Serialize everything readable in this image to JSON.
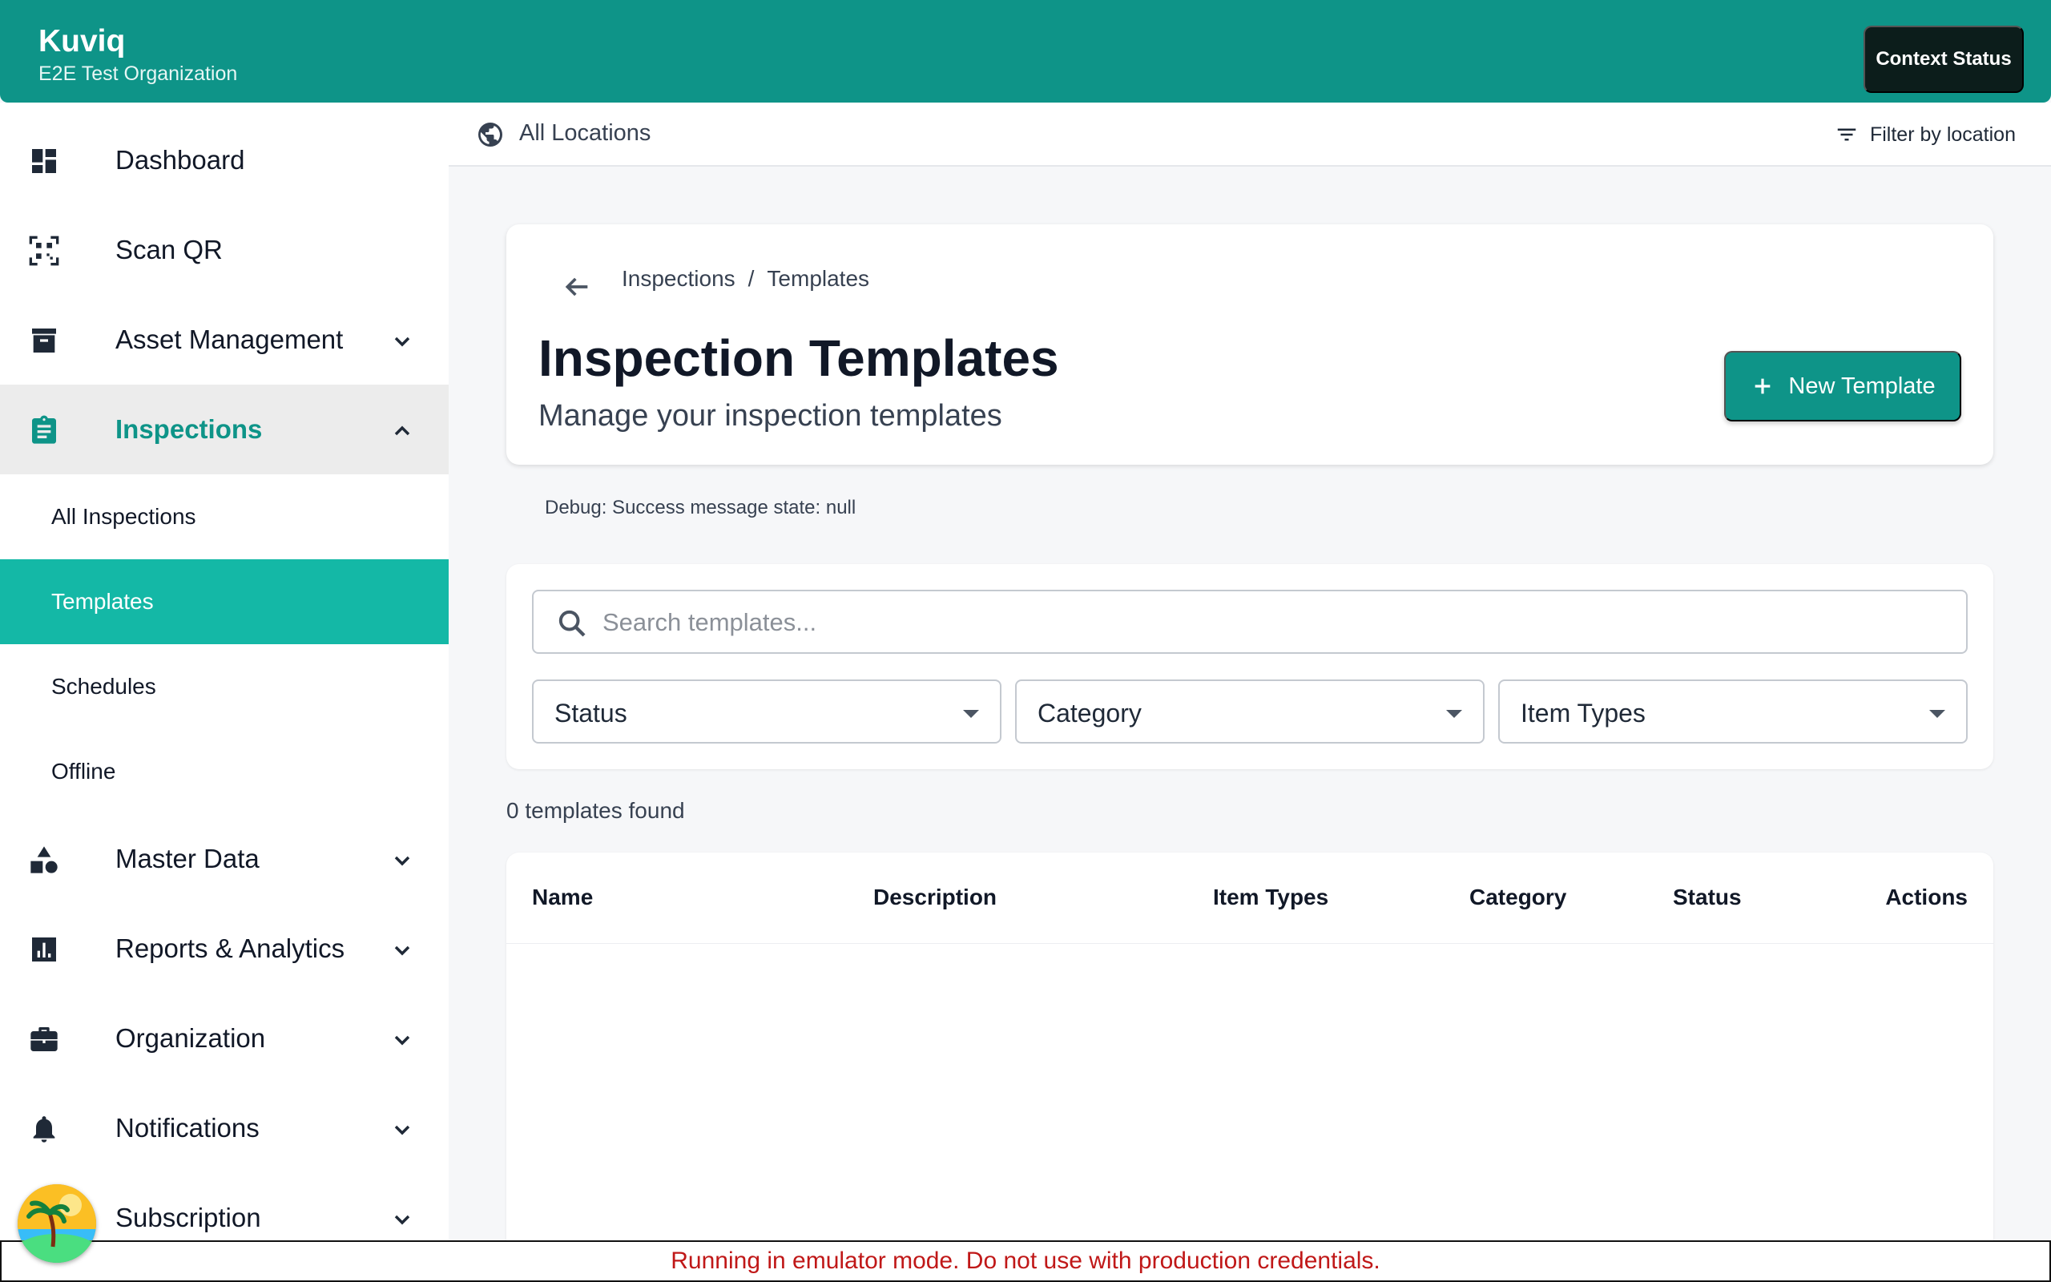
{
  "app": {
    "name": "Kuviq",
    "organization": "E2E Test Organization",
    "context_status_label": "Context Status",
    "accent_color": "#0e9488"
  },
  "sidebar": {
    "items": [
      {
        "label": "Dashboard",
        "icon": "dashboard-icon"
      },
      {
        "label": "Scan QR",
        "icon": "qr-scan-icon"
      },
      {
        "label": "Asset Management",
        "icon": "archive-box-icon",
        "expandable": true
      },
      {
        "label": "Inspections",
        "icon": "clipboard-icon",
        "expanded": true,
        "active": true
      },
      {
        "label": "Master Data",
        "icon": "shapes-icon",
        "expandable": true
      },
      {
        "label": "Reports & Analytics",
        "icon": "bar-chart-icon",
        "expandable": true
      },
      {
        "label": "Organization",
        "icon": "briefcase-icon",
        "expandable": true
      },
      {
        "label": "Notifications",
        "icon": "bell-icon",
        "expandable": true
      },
      {
        "label": "Subscription",
        "icon": "avatar-icon",
        "expandable": true
      }
    ],
    "inspections_sub": [
      {
        "label": "All Inspections"
      },
      {
        "label": "Templates",
        "selected": true
      },
      {
        "label": "Schedules"
      },
      {
        "label": "Offline"
      }
    ]
  },
  "location_bar": {
    "current": "All Locations",
    "filter_label": "Filter by location"
  },
  "header": {
    "breadcrumb": [
      "Inspections",
      "Templates"
    ],
    "breadcrumb_separator": "/",
    "title": "Inspection Templates",
    "subtitle": "Manage your inspection templates",
    "new_button_label": "New Template"
  },
  "debug": "Debug: Success message state: null",
  "filters": {
    "search_placeholder": "Search templates...",
    "search_value": "",
    "status_label": "Status",
    "category_label": "Category",
    "item_types_label": "Item Types"
  },
  "results": {
    "count_text": "0 templates found"
  },
  "table": {
    "columns": [
      "Name",
      "Description",
      "Item Types",
      "Category",
      "Status",
      "Actions"
    ],
    "rows": []
  },
  "banner": {
    "text": "Running in emulator mode. Do not use with production credentials."
  }
}
